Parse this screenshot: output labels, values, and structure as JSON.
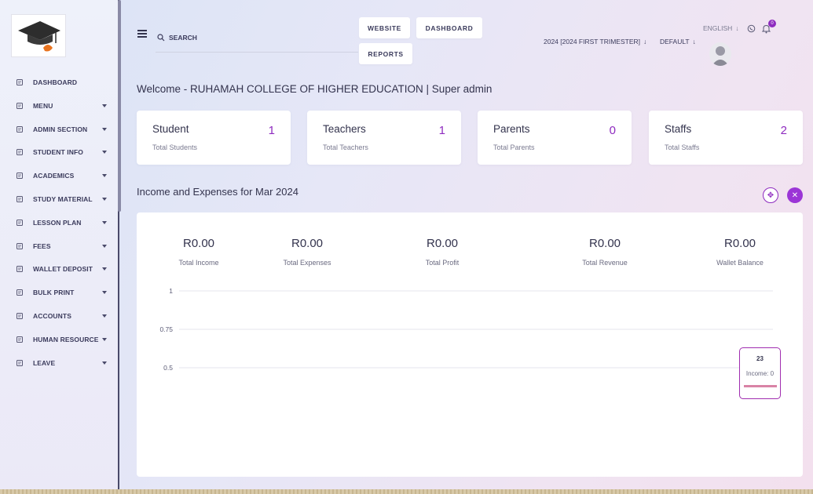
{
  "sidebar": {
    "items": [
      {
        "label": "DASHBOARD",
        "icon": "dashboard-icon",
        "has_caret": false
      },
      {
        "label": "MENU",
        "icon": "menu-icon",
        "has_caret": true
      },
      {
        "label": "ADMIN SECTION",
        "icon": "admin-icon",
        "has_caret": true
      },
      {
        "label": "STUDENT INFO",
        "icon": "student-icon",
        "has_caret": true
      },
      {
        "label": "ACADEMICS",
        "icon": "academics-icon",
        "has_caret": true
      },
      {
        "label": "STUDY MATERIAL",
        "icon": "study-material-icon",
        "has_caret": true
      },
      {
        "label": "LESSON PLAN",
        "icon": "lesson-plan-icon",
        "has_caret": true
      },
      {
        "label": "FEES",
        "icon": "fees-icon",
        "has_caret": true
      },
      {
        "label": "WALLET DEPOSIT",
        "icon": "wallet-icon",
        "has_caret": true
      },
      {
        "label": "BULK PRINT",
        "icon": "print-icon",
        "has_caret": true
      },
      {
        "label": "ACCOUNTS",
        "icon": "accounts-icon",
        "has_caret": true
      },
      {
        "label": "HUMAN RESOURCE",
        "icon": "human-resource-icon",
        "has_caret": true
      },
      {
        "label": "LEAVE",
        "icon": "leave-icon",
        "has_caret": true
      }
    ]
  },
  "topbar": {
    "search_label": "SEARCH",
    "website_label": "WEBSITE",
    "dashboard_label": "DASHBOARD",
    "reports_label": "REPORTS",
    "session_label": "2024 [2024 FIRST TRIMESTER]",
    "branch_label": "DEFAULT",
    "language_label": "ENGLISH",
    "notification_count": "0"
  },
  "welcome": "Welcome - RUHAMAH COLLEGE OF HIGHER EDUCATION | Super admin",
  "stats": [
    {
      "title": "Student",
      "sub": "Total Students",
      "value": "1"
    },
    {
      "title": "Teachers",
      "sub": "Total Teachers",
      "value": "1"
    },
    {
      "title": "Parents",
      "sub": "Total Parents",
      "value": "0"
    },
    {
      "title": "Staffs",
      "sub": "Total Staffs",
      "value": "2"
    }
  ],
  "income_section": {
    "title": "Income and Expenses for Mar 2024",
    "summary": [
      {
        "value": "R0.00",
        "label": "Total Income"
      },
      {
        "value": "R0.00",
        "label": "Total Expenses"
      },
      {
        "value": "R0.00",
        "label": "Total Profit"
      },
      {
        "value": "R0.00",
        "label": "Total Revenue"
      },
      {
        "value": "R0.00",
        "label": "Wallet Balance"
      }
    ],
    "tooltip": {
      "day": "23",
      "income": "Income: 0"
    }
  },
  "chart_data": {
    "type": "line",
    "y_ticks": [
      "1",
      "0.75",
      "0.5"
    ],
    "ylim": [
      0.5,
      1
    ],
    "grid": true
  },
  "colors": {
    "accent": "#8e2bbf",
    "text": "#33334d"
  }
}
